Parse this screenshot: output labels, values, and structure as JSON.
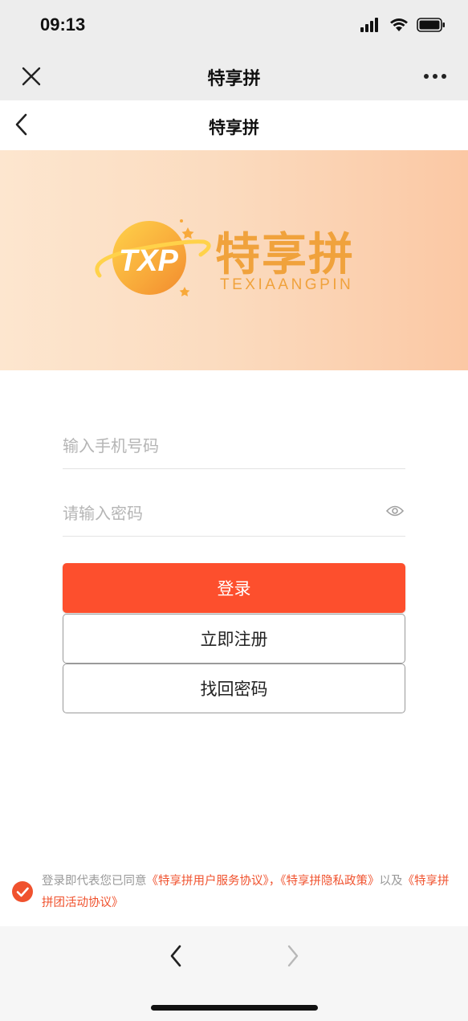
{
  "status_bar": {
    "time": "09:13"
  },
  "wechat_bar": {
    "title": "特享拼"
  },
  "header": {
    "title": "特享拼"
  },
  "banner": {
    "logo_text": "TXP",
    "brand_cn": "特享拼",
    "brand_en": "TEXIAANGPIN"
  },
  "form": {
    "phone_placeholder": "输入手机号码",
    "password_placeholder": "请输入密码"
  },
  "buttons": {
    "login": "登录",
    "register": "立即注册",
    "recover": "找回密码"
  },
  "agreement": {
    "prefix": "登录即代表您已同意",
    "link1": "《特享拼用户服务协议》，",
    "link2": "《特享拼隐私政策》",
    "middle": "以及",
    "link3": "《特享拼拼团活动协议》"
  },
  "colors": {
    "accent": "#fd4f2d",
    "brand": "#f0a23c",
    "link": "#f0522e"
  }
}
